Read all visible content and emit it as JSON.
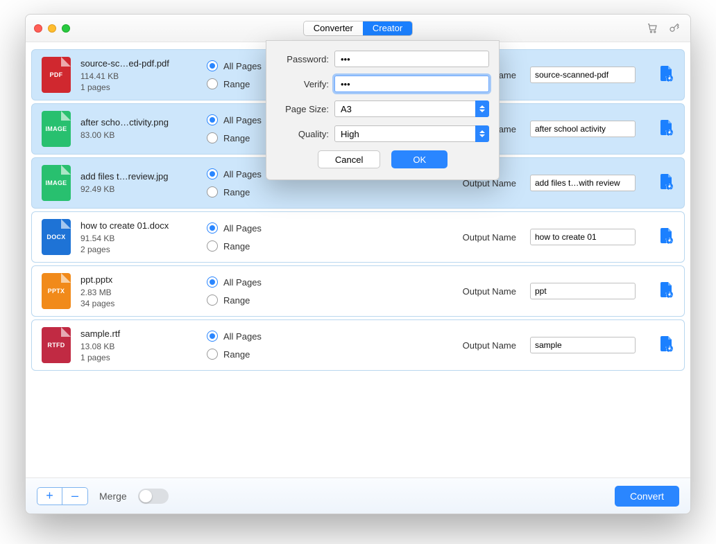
{
  "tabs": {
    "converter": "Converter",
    "creator": "Creator",
    "active": "creator"
  },
  "labels": {
    "all_pages": "All Pages",
    "range": "Range",
    "output_name": "Output Name",
    "merge": "Merge",
    "convert": "Convert",
    "add": "+",
    "remove": "–"
  },
  "modal": {
    "password_label": "Password:",
    "verify_label": "Verify:",
    "pagesize_label": "Page Size:",
    "quality_label": "Quality:",
    "password_value": "•••",
    "verify_value": "•••",
    "pagesize_value": "A3",
    "quality_value": "High",
    "cancel": "Cancel",
    "ok": "OK"
  },
  "files": [
    {
      "type": "pdf",
      "type_label": "PDF",
      "name": "source-sc…ed-pdf.pdf",
      "size": "114.41 KB",
      "pages": "1 pages",
      "output": "source-scanned-pdf",
      "selected": true
    },
    {
      "type": "image",
      "type_label": "IMAGE",
      "name": "after scho…ctivity.png",
      "size": "83.00 KB",
      "pages": "",
      "output": "after school activity",
      "selected": true
    },
    {
      "type": "image",
      "type_label": "IMAGE",
      "name": "add files t…review.jpg",
      "size": "92.49 KB",
      "pages": "",
      "output": "add files t…with review",
      "selected": true
    },
    {
      "type": "docx",
      "type_label": "DOCX",
      "name": "how to create 01.docx",
      "size": "91.54 KB",
      "pages": "2 pages",
      "output": "how to create 01",
      "selected": false
    },
    {
      "type": "pptx",
      "type_label": "PPTX",
      "name": "ppt.pptx",
      "size": "2.83 MB",
      "pages": "34 pages",
      "output": "ppt",
      "selected": false
    },
    {
      "type": "rtfd",
      "type_label": "RTFD",
      "name": "sample.rtf",
      "size": "13.08 KB",
      "pages": "1 pages",
      "output": "sample",
      "selected": false
    }
  ]
}
